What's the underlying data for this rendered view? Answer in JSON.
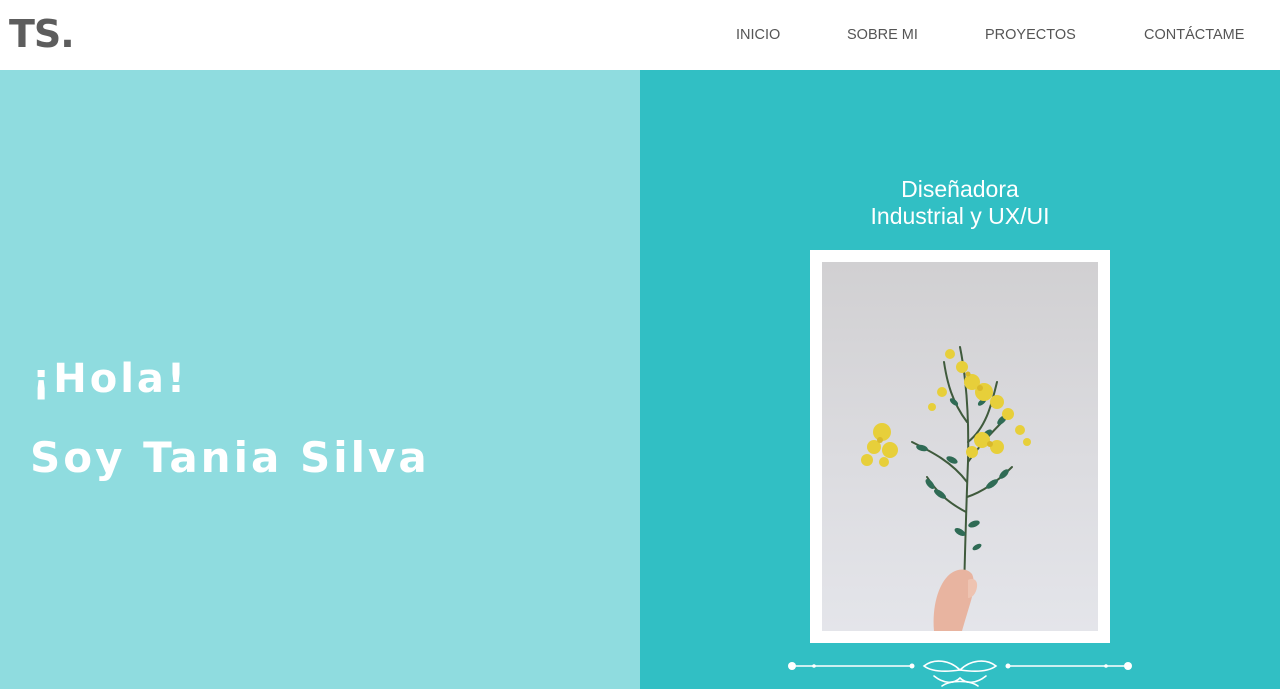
{
  "header": {
    "logo": "TS.",
    "nav": [
      {
        "label": "INICIO"
      },
      {
        "label": "SOBRE MI"
      },
      {
        "label": "PROYECTOS"
      },
      {
        "label": "CONTÁCTAME"
      }
    ]
  },
  "hero": {
    "greeting": "¡Hola!",
    "name": "Soy Tania Silva",
    "subtitle_line1": "Diseñadora",
    "subtitle_line2": "Industrial y UX/UI"
  },
  "colors": {
    "left_panel": "#8fdcdf",
    "right_panel": "#31bfc4",
    "nav_text": "#555555",
    "logo": "#5d5d5d"
  },
  "icons": {
    "ornament": "decorative-flourish-divider-icon"
  }
}
